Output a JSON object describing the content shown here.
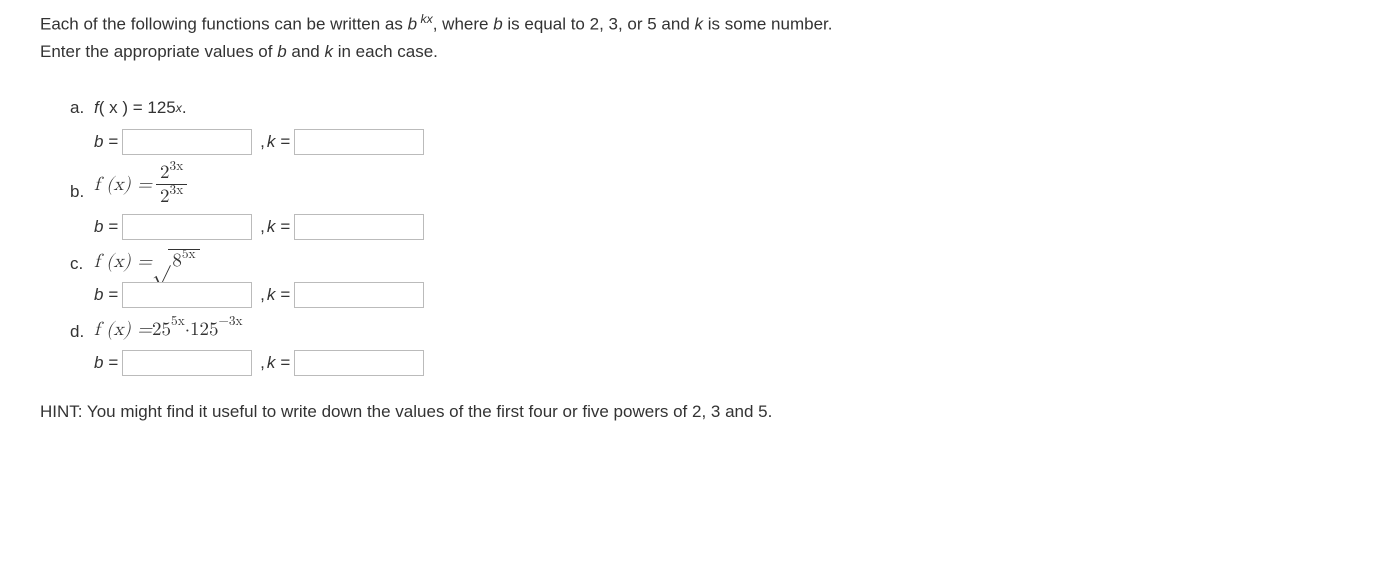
{
  "intro_line1_pre": "Each of the following functions can be written as ",
  "intro_b": "b",
  "intro_exp": " kx",
  "intro_line1_post": ", where ",
  "intro_b2": "b",
  "intro_line1_post2": " is equal to 2, 3, or 5 and ",
  "intro_k": "k",
  "intro_line1_end": " is some number.",
  "intro_line2_pre": "Enter the appropriate values of ",
  "intro_line2_mid": " and ",
  "intro_line2_end": " in each case.",
  "items": {
    "a": {
      "letter": "a.",
      "fn_pre": "f",
      "fn_mid": "( x ) = 125",
      "fn_sup": "x",
      "fn_post": "."
    },
    "b": {
      "letter": "b.",
      "fx": "f (x) = ",
      "num_base": "2",
      "num_exp": "3x",
      "den_base": "2",
      "den_exp": "3x"
    },
    "c": {
      "letter": "c.",
      "fx": "f (x) = ",
      "body_base": "8",
      "body_exp": "5x"
    },
    "d": {
      "letter": "d.",
      "fx": "f (x) = ",
      "t1_base": "25",
      "t1_exp": "5x",
      "dot": " · ",
      "t2_base": "125",
      "t2_exp": "−3x"
    }
  },
  "labels": {
    "b_eq": "b =",
    "k_eq": "k =",
    "comma": ", "
  },
  "hint": "HINT: You might find it useful to write down the values of the first four or five powers of 2, 3 and 5."
}
